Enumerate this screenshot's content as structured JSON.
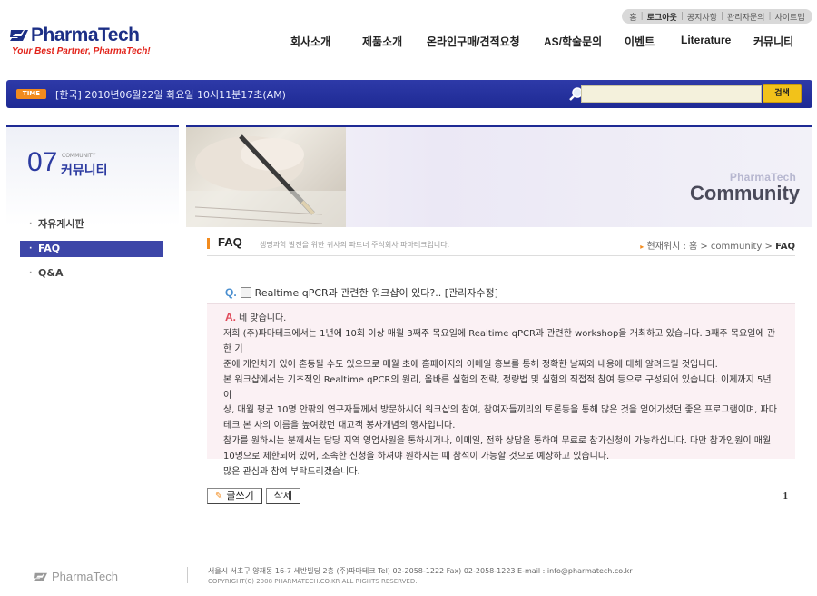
{
  "util_links": [
    "홈",
    "로그아웃",
    "공지사항",
    "관리자문의",
    "사이트맵"
  ],
  "logo": {
    "text": "PharmaTech",
    "tagline": "Your Best Partner, PharmaTech!"
  },
  "gnb": [
    "회사소개",
    "제품소개",
    "온라인구매/견적요청",
    "AS/학술문의",
    "이벤트",
    "Literature",
    "커뮤니티"
  ],
  "timebar": {
    "badge": "TIME",
    "text": "[한국] 2010년06월22일 화요일 10시11분17초(AM)",
    "search_value": "",
    "search_button": "검색"
  },
  "lnb": {
    "num": "07",
    "eng": "COMMUNITY",
    "kor": "커뮤니티",
    "items": [
      {
        "label": "자유게시판",
        "active": false
      },
      {
        "label": "FAQ",
        "active": true
      },
      {
        "label": "Q&A",
        "active": false
      }
    ]
  },
  "visual": {
    "brand": "PharmaTech",
    "title": "Community"
  },
  "content": {
    "title": "FAQ",
    "subtitle": "생명과학 발전을 위한 귀사의 파트너 주식회사 파마테크입니다.",
    "location_prefix": "현재위치 : 홈 > community > ",
    "location_current": "FAQ",
    "question_mark": "Q.",
    "question": "Realtime qPCR과 관련한 워크샵이 있다?.. [관리자수정]",
    "answer_mark": "A.",
    "answer_lines": [
      "네 맞습니다.",
      "저희 (주)파마테크에서는  1년에 10회 이상 매월 3째주 목요일에 Realtime qPCR과 관련한 workshop을 개최하고 있습니다. 3째주 목요일에 관한 기",
      "준에 개인차가 있어 혼동될 수도 있으므로 매월 초에 홈페이지와 이메일 홍보를 통해 정확한 날짜와 내용에 대해 알려드릴 것입니다.",
      "본 워크샵에서는 기초적인 Realtime qPCR의 원리, 올바른 실험의 전략, 정량법 및 실험의 직접적 참여 등으로 구성되어 있습니다. 이제까지 5년 이",
      "상, 매월 평균 10명 안팎의 연구자들께서 방문하시어 워크샵의 참여, 참여자들끼리의 토론등을 통해 많은 것을 얻어가셨던 좋은 프로그램이며, 파마",
      "테크 본 사의 이름을 높여왔던 대고객 봉사개념의 행사입니다.",
      "참가를 원하시는 분께서는 담당 지역 영업사원을 통하시거나, 이메일, 전화 상담을 통하여 무료로 참가신청이 가능하십니다. 다만 참가인원이 매월",
      "10명으로 제한되어 있어, 조속한 신청을 하셔야 원하시는 때 참석이 가능할 것으로 예상하고 있습니다.",
      "많은 관심과 참여 부탁드리겠습니다."
    ],
    "write_button": "글쓰기",
    "delete_button": "삭제",
    "page": "1"
  },
  "footer": {
    "logo": "PharmaTech",
    "address": "서울시 서초구 양재동 16-7 세반빌딩 2층 (주)파마테크  Tel) 02-2058-1222  Fax) 02-2058-1223   E-mail : info@pharmatech.co.kr",
    "copyright": "COPYRIGHT(C) 2008 PHARMATECH.CO.KR ALL RIGHTS RESERVED."
  },
  "colors": {
    "brand_blue": "#1c2f86",
    "accent_orange": "#f28b1e",
    "answer_bg": "#fbf1f4",
    "active_menu": "#3d46a8"
  }
}
